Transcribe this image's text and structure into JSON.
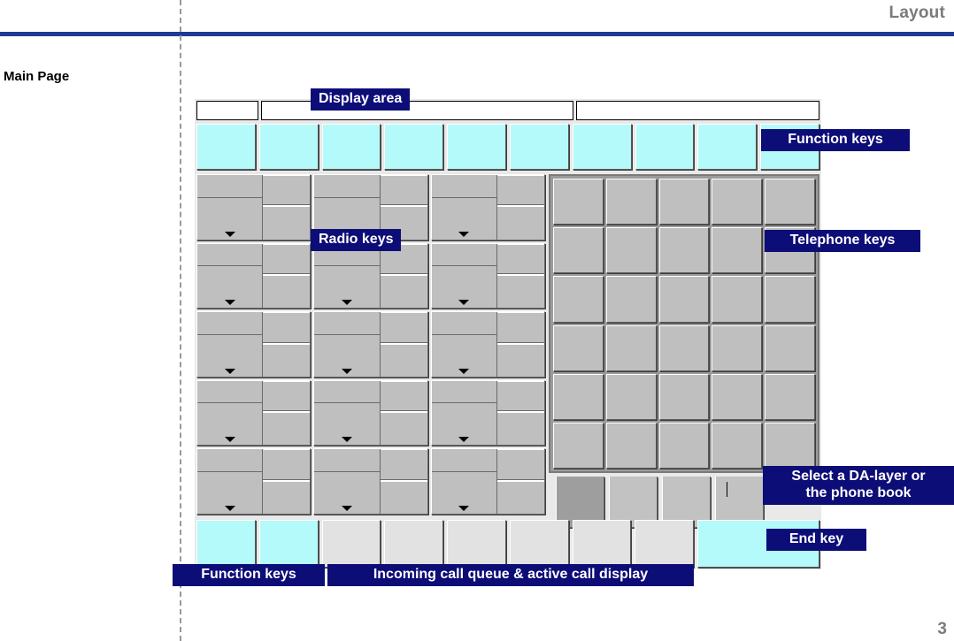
{
  "slide": {
    "header_title": "Layout",
    "page_heading": "Main Page",
    "page_number": "3"
  },
  "callouts": {
    "display_area": "Display area",
    "function_keys_top": "Function keys",
    "radio_keys": "Radio keys",
    "telephone_keys": "Telephone keys",
    "da_layer": "Select a DA-layer or\nthe phone book",
    "end_key": "End key",
    "function_keys_bottom": "Function keys",
    "call_queue": "Incoming call queue & active call display"
  },
  "colors": {
    "accent_blue": "#0d0d77",
    "rule_blue": "#1f3a93",
    "cyan_key": "#b5fafa",
    "grey_key": "#bfbfbf",
    "light_grey_key": "#e2e2e2",
    "panel_grey": "#9b9b9b",
    "header_text": "#7b7b7b"
  },
  "device": {
    "display_boxes": 3,
    "function_keys_top_count": 10,
    "radio_keys": {
      "columns": 3,
      "rows": 5,
      "count": 15
    },
    "telephone_keys": {
      "columns": 5,
      "rows": 6,
      "count": 30
    },
    "da_tabs": {
      "count": 4,
      "selected_index": 0,
      "caret_index": 3
    },
    "bottom_row": {
      "function_keys_count": 2,
      "call_queue_keys_count": 6,
      "end_keys_count": 1
    }
  }
}
